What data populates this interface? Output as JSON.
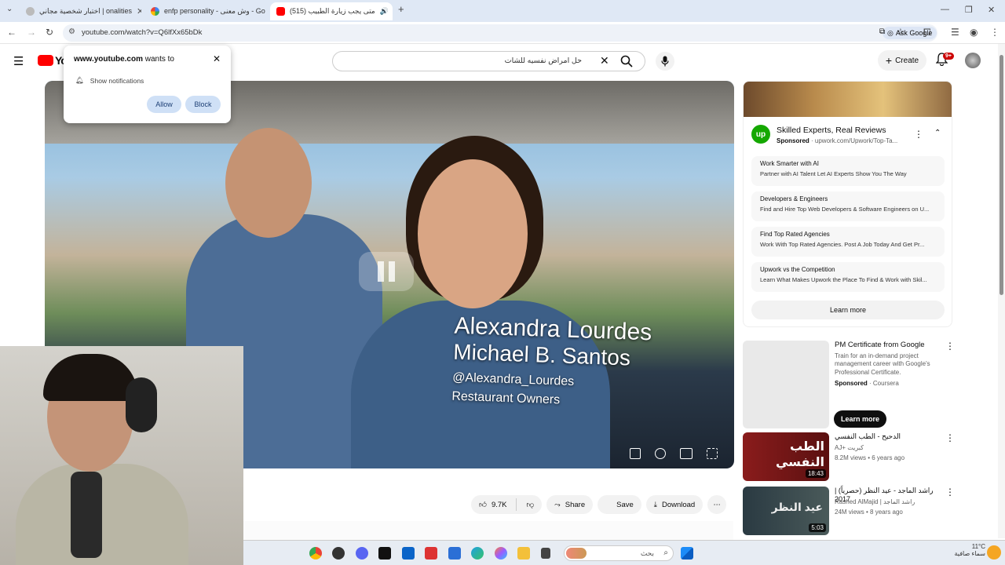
{
  "browser": {
    "tabs": [
      {
        "label": "اختبار شخصية مجاني | onalities",
        "active": false
      },
      {
        "label": "enfp personality - وش معنى - Go",
        "active": false
      },
      {
        "label": "(515) متى يجب زيارة الطبيب",
        "active": true
      }
    ],
    "new_tab": "+",
    "url": "youtube.com/watch?v=Q6lfXx65bDk",
    "ask_google": "Ask Google"
  },
  "youtube": {
    "logo_text": "Yo",
    "search_value": "حل امراض نفسيه للشات",
    "create_label": "Create",
    "notification_badge": "9+"
  },
  "notification_prompt": {
    "site": "www.youtube.com",
    "wants_to": "wants to",
    "permission": "Show notifications",
    "allow": "Allow",
    "block": "Block"
  },
  "video": {
    "overlay_name1": "Alexandra Lourdes",
    "overlay_name2": "Michael B. Santos",
    "overlay_handle": "@Alexandra_Lourdes",
    "overlay_role": "Restaurant Owners"
  },
  "actions": {
    "likes": "9.7K",
    "share": "Share",
    "save": "Save",
    "download": "Download"
  },
  "ad": {
    "logo": "up",
    "title": "Skilled Experts, Real Reviews",
    "sponsored": "Sponsored",
    "url": "upwork.com/Upwork/Top-Ta...",
    "links": [
      {
        "title": "Work Smarter with AI",
        "desc": "Partner with AI Talent Let AI Experts Show You The Way"
      },
      {
        "title": "Developers & Engineers",
        "desc": "Find and Hire Top Web Developers & Software Engineers on U..."
      },
      {
        "title": "Find Top Rated Agencies",
        "desc": "Work With Top Rated Agencies. Post A Job Today And Get Pr..."
      },
      {
        "title": "Upwork vs the Competition",
        "desc": "Learn What Makes Upwork the Place To Find & Work with Skil..."
      }
    ],
    "learn_more": "Learn more"
  },
  "promo": {
    "title": "PM Certificate from Google",
    "desc": "Train for an in-demand project management career with Google's Professional Certificate.",
    "sponsored": "Sponsored",
    "advertiser": "Coursera",
    "cta": "Learn more"
  },
  "recommendations": [
    {
      "title": "الدحيح - الطب النفسي",
      "channel": "AJ+ كبريت",
      "meta": "8.2M views • 6 years ago",
      "duration": "18:43",
      "thumb_text": "الطب النفسي"
    },
    {
      "title": "راشد الماجد - عيد النظر (حصرياً) | 2017",
      "channel": "Rashed AlMajid | راشد الماجد",
      "meta": "24M views • 8 years ago",
      "duration": "5:03",
      "thumb_text": "عيد النظر"
    }
  ],
  "taskbar": {
    "search_placeholder": "بحث",
    "weather_temp": "11°C",
    "weather_desc": "سماء صافية"
  }
}
